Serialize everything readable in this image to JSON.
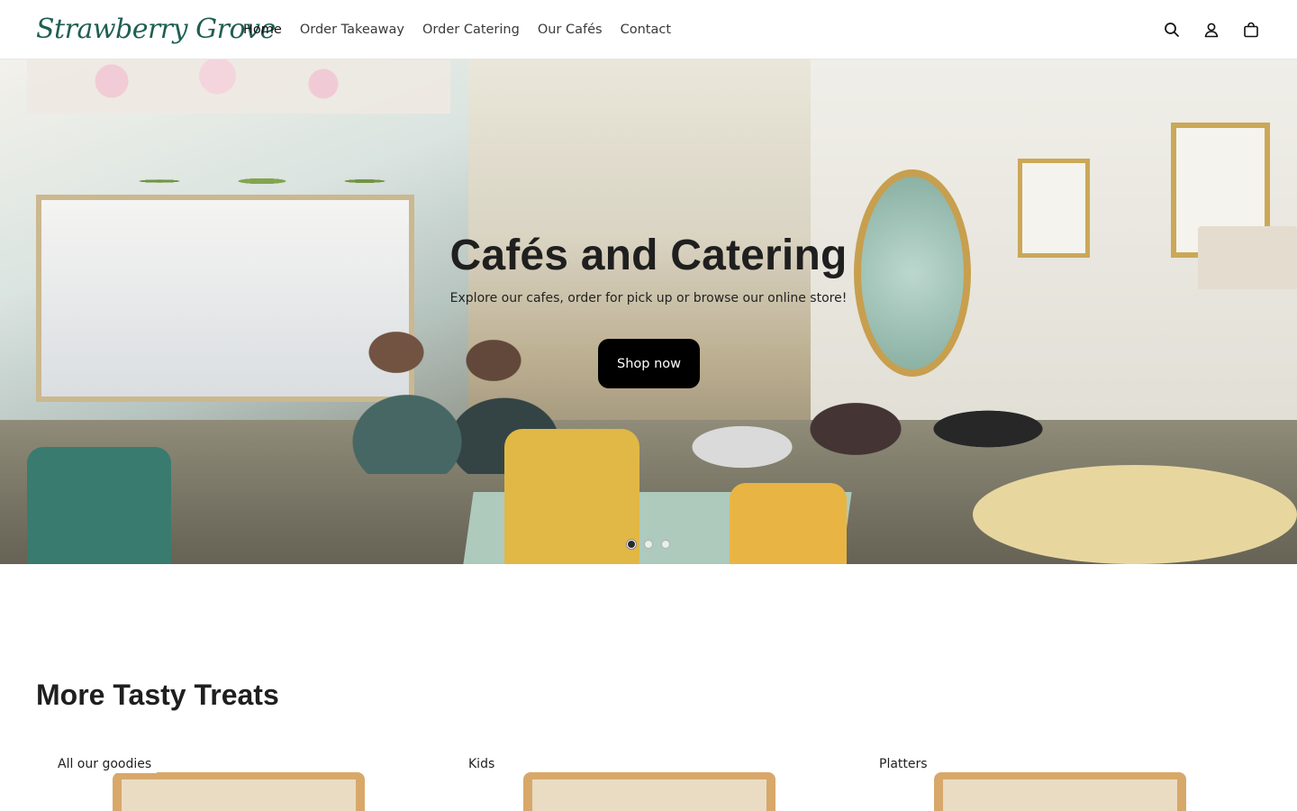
{
  "header": {
    "logo_text": "Strawberry Grove",
    "nav": [
      {
        "label": "Home"
      },
      {
        "label": "Order Takeaway"
      },
      {
        "label": "Order Catering"
      },
      {
        "label": "Our Cafés"
      },
      {
        "label": "Contact"
      }
    ],
    "icons": [
      "search-icon",
      "account-icon",
      "cart-icon"
    ]
  },
  "hero": {
    "title": "Cafés and Catering",
    "subtitle": "Explore our cafes, order for pick up or browse our online store!",
    "button_label": "Shop now",
    "slides_count": 3,
    "active_slide": 1
  },
  "collections": {
    "title": "More Tasty Treats",
    "items": [
      {
        "label": "All our goodies"
      },
      {
        "label": "Kids"
      },
      {
        "label": "Platters"
      }
    ]
  },
  "colors": {
    "brand": "#1f5f52",
    "button_bg": "#000000",
    "button_text": "#ffffff"
  }
}
